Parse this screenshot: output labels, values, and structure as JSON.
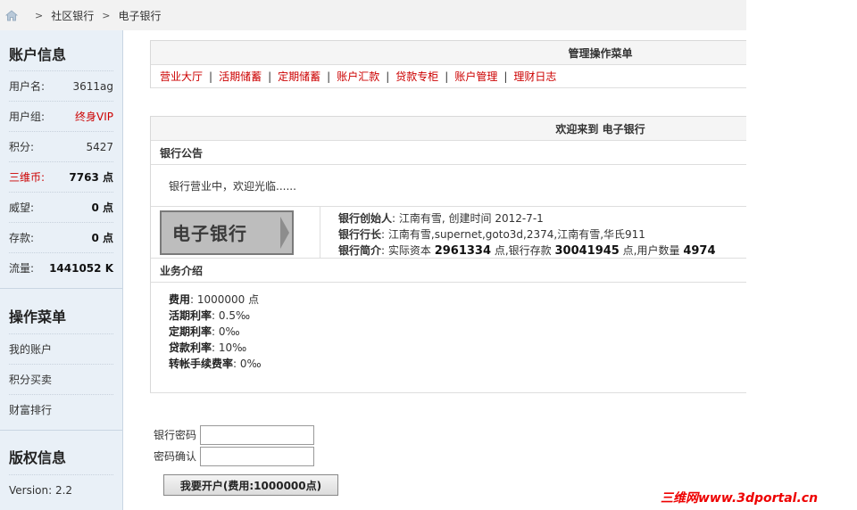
{
  "breadcrumb": {
    "items": [
      "社区银行",
      "电子银行"
    ],
    "separator": ">"
  },
  "sidebar": {
    "account_title": "账户信息",
    "rows": [
      {
        "label": "用户名:",
        "value": "3611ag"
      },
      {
        "label": "用户组:",
        "value": "终身VIP"
      },
      {
        "label": "积分:",
        "value": "5427"
      },
      {
        "label": "三维币:",
        "value": "7763 点"
      },
      {
        "label": "威望:",
        "value": "0 点"
      },
      {
        "label": "存款:",
        "value": "0 点"
      },
      {
        "label": "流量:",
        "value": "1441052 K"
      }
    ],
    "menu_title": "操作菜单",
    "menu_items": [
      "我的账户",
      "积分买卖",
      "财富排行"
    ],
    "copyright_title": "版权信息",
    "version": "Version: 2.2"
  },
  "admin_menu": {
    "title": "管理操作菜单",
    "links": [
      "营业大厅",
      "活期储蓄",
      "定期储蓄",
      "账户汇款",
      "贷款专柜",
      "账户管理",
      "理财日志"
    ]
  },
  "welcome": {
    "title": "欢迎来到 电子银行",
    "notice_title": "银行公告",
    "notice_text": "银行营业中，欢迎光临......",
    "logo_text": "电子银行",
    "founder_label": "银行创始人",
    "founder_value": ": 江南有雪, 创建时间 2012-7-1",
    "president_label": "银行行长",
    "president_value": ": 江南有雪,supernet,goto3d,2374,江南有雪,华氏911",
    "intro_label": "银行简介",
    "intro_prefix": ": 实际资本 ",
    "capital": "2961334",
    "intro_mid1": " 点,银行存款 ",
    "deposit": "30041945",
    "intro_mid2": " 点,用户数量 ",
    "users": "4974"
  },
  "business": {
    "title": "业务介绍",
    "items": [
      {
        "label": "费用",
        "value": ": 1000000 点"
      },
      {
        "label": "活期利率",
        "value": ": 0.5‰"
      },
      {
        "label": "定期利率",
        "value": ": 0‰"
      },
      {
        "label": "贷款利率",
        "value": ": 10‰"
      },
      {
        "label": "转帐手续费率",
        "value": ": 0‰"
      }
    ]
  },
  "form": {
    "password_label": "银行密码",
    "confirm_label": "密码确认",
    "submit_label": "我要开户(费用:1000000点)"
  },
  "watermark": "三维网www.3dportal.cn",
  "colors": {
    "link_red": "#cc0000",
    "sidebar_bg": "#e9f0f7"
  }
}
